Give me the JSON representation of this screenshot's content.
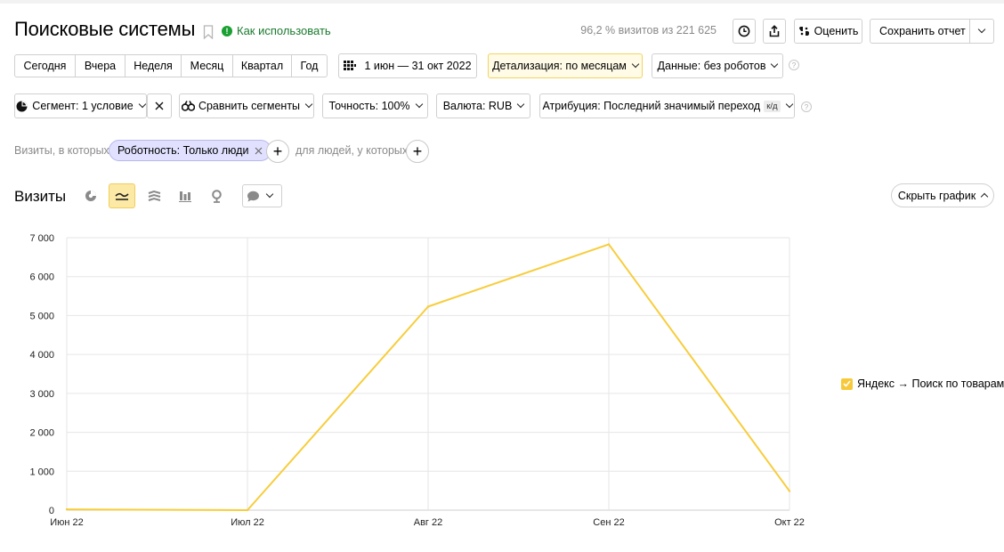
{
  "header": {
    "title": "Поисковые системы",
    "howto_label": "Как использовать",
    "visits_share": "96,2 % визитов из 221 625",
    "rate_label": "Оценить",
    "save_report_label": "Сохранить отчет"
  },
  "periods": [
    "Сегодня",
    "Вчера",
    "Неделя",
    "Месяц",
    "Квартал",
    "Год"
  ],
  "toolbar": {
    "date_range": "1 июн — 31 окт 2022",
    "detail": "Детализация: по месяцам",
    "data": "Данные: без роботов",
    "segment": "Сегмент: 1 условие",
    "compare": "Сравнить сегменты",
    "accuracy": "Точность: 100%",
    "currency": "Валюта: RUB",
    "attribution": "Атрибуция: Последний значимый переход",
    "attribution_badge": "к/д"
  },
  "filters": {
    "visits_label": "Визиты, в которых",
    "chip_label": "Роботность: Только люди",
    "people_label": "для людей, у которых"
  },
  "section": {
    "title": "Визиты",
    "hide_chart_label": "Скрыть график"
  },
  "colors": {
    "series": "#f7cd3c",
    "accent_active": "#fde9a6",
    "howto": "#1aa033",
    "chip_bg": "#e1e1ff"
  },
  "chart_data": {
    "type": "line",
    "categories": [
      "Июн 22",
      "Июл 22",
      "Авг 22",
      "Сен 22",
      "Окт 22"
    ],
    "series": [
      {
        "name": "Яндекс → Поиск по товарам",
        "values": [
          20,
          0,
          5230,
          6830,
          490
        ]
      }
    ],
    "ylim": [
      0,
      7000
    ],
    "yticks": [
      0,
      1000,
      2000,
      3000,
      4000,
      5000,
      6000,
      7000
    ],
    "ytick_labels": [
      "0",
      "1 000",
      "2 000",
      "3 000",
      "4 000",
      "5 000",
      "6 000",
      "7 000"
    ],
    "grid": true,
    "legend": "right"
  }
}
